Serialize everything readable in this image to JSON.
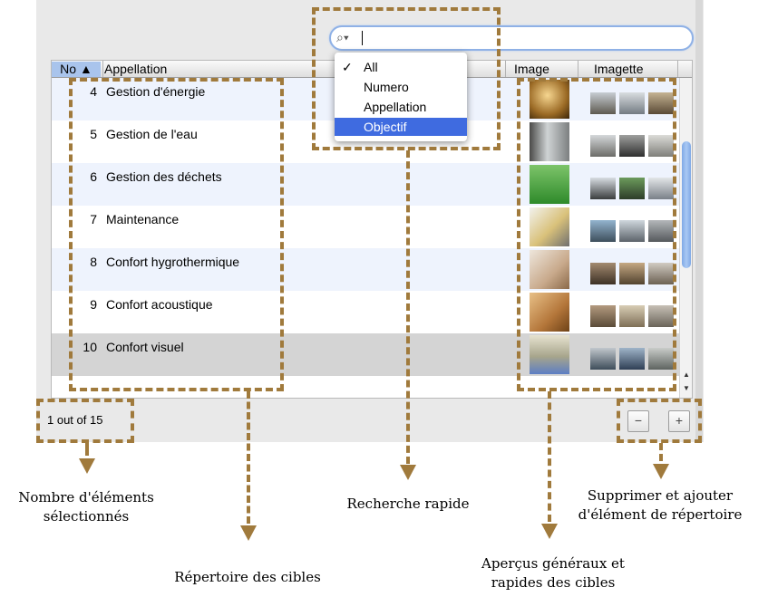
{
  "search": {
    "icon": "search-icon",
    "value": ""
  },
  "menu": {
    "items": [
      {
        "label": "All",
        "checked": true
      },
      {
        "label": "Numero",
        "checked": false
      },
      {
        "label": "Appellation",
        "checked": false
      },
      {
        "label": "Objectif",
        "checked": false,
        "highlighted": true
      }
    ],
    "check_mark": "✓"
  },
  "table": {
    "columns": {
      "no": "No ▲",
      "appellation": "Appellation",
      "image": "Image",
      "thumbnail": "Imagette"
    },
    "rows": [
      {
        "no": "4",
        "name": "Gestion d'énergie"
      },
      {
        "no": "5",
        "name": "Gestion de l'eau"
      },
      {
        "no": "6",
        "name": "Gestion des déchets"
      },
      {
        "no": "7",
        "name": "Maintenance"
      },
      {
        "no": "8",
        "name": "Confort hygrothermique"
      },
      {
        "no": "9",
        "name": "Confort acoustique"
      },
      {
        "no": "10",
        "name": "Confort visuel"
      }
    ],
    "selected_row": "10"
  },
  "status": {
    "count": "1 out of 15"
  },
  "buttons": {
    "remove": "−",
    "add": "+"
  },
  "annotations": {
    "count": "Nombre d'éléments\nsélectionnés",
    "directory": "Répertoire des cibles",
    "search": "Recherche rapide",
    "previews": "Aperçus généraux et\nrapides des cibles",
    "add_remove": "Supprimer et ajouter\nd'élément de répertoire"
  },
  "colors": {
    "annotation": "#a07a3c",
    "selection": "#3f6be0",
    "header_sort": "#a9c4ec"
  }
}
